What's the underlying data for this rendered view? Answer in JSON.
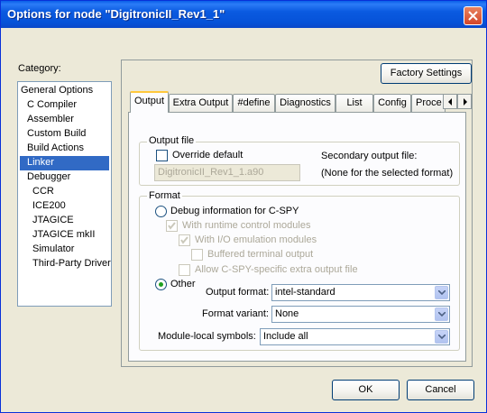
{
  "window": {
    "title": "Options for node \"DigitronicII_Rev1_1\""
  },
  "category": {
    "label": "Category:",
    "items": [
      {
        "label": "General Options"
      },
      {
        "label": "C Compiler"
      },
      {
        "label": "Assembler"
      },
      {
        "label": "Custom Build"
      },
      {
        "label": "Build Actions"
      },
      {
        "label": "Linker"
      },
      {
        "label": "Debugger"
      },
      {
        "label": "CCR"
      },
      {
        "label": "ICE200"
      },
      {
        "label": "JTAGICE"
      },
      {
        "label": "JTAGICE mkII"
      },
      {
        "label": "Simulator"
      },
      {
        "label": "Third-Party Driver"
      }
    ],
    "selected": "Linker"
  },
  "factory_settings": "Factory Settings",
  "tabs": [
    {
      "label": "Output"
    },
    {
      "label": "Extra Output"
    },
    {
      "label": "#define"
    },
    {
      "label": "Diagnostics"
    },
    {
      "label": "List"
    },
    {
      "label": "Config"
    },
    {
      "label": "Proce"
    }
  ],
  "output_file": {
    "group_title": "Output file",
    "override_label": "Override default",
    "filename": "DigitronicII_Rev1_1.a90",
    "secondary_label": "Secondary output file:",
    "secondary_value": "(None for the selected format)"
  },
  "format": {
    "group_title": "Format",
    "debug_info": "Debug information for C-SPY",
    "runtime_control": "With runtime control modules",
    "io_emulation": "With I/O emulation modules",
    "buffered_terminal": "Buffered terminal output",
    "allow_extra": "Allow C-SPY-specific extra output file",
    "other": "Other",
    "output_format_label": "Output format:",
    "output_format_value": "intel-standard",
    "format_variant_label": "Format variant:",
    "format_variant_value": "None",
    "module_local_label": "Module-local symbols:",
    "module_local_value": "Include all"
  },
  "buttons": {
    "ok": "OK",
    "cancel": "Cancel"
  }
}
